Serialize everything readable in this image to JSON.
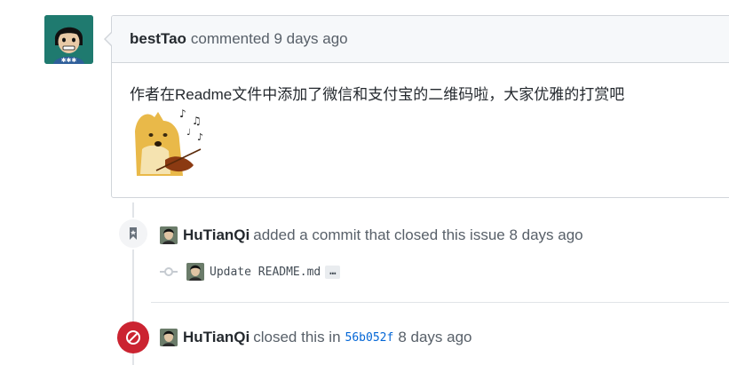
{
  "comment": {
    "author": "bestTao",
    "action": "commented 9 days ago",
    "body": "作者在Readme文件中添加了微信和支付宝的二维码啦，大家优雅的打赏吧"
  },
  "events": {
    "commit_event": {
      "actor": "HuTianQi",
      "text": "added a commit that closed this issue 8 days ago",
      "commit_message": "Update README.md",
      "ellipsis": "…"
    },
    "closed_event": {
      "actor": "HuTianQi",
      "text_before": "closed this in",
      "sha": "56b052f",
      "text_after": "8 days ago"
    }
  },
  "icons": {
    "commit_badge": "bookmark-icon",
    "closed_badge": "circle-slash-icon",
    "commit_node": "git-commit-icon"
  },
  "colors": {
    "closed": "#cb2431",
    "link": "#0366d6"
  }
}
